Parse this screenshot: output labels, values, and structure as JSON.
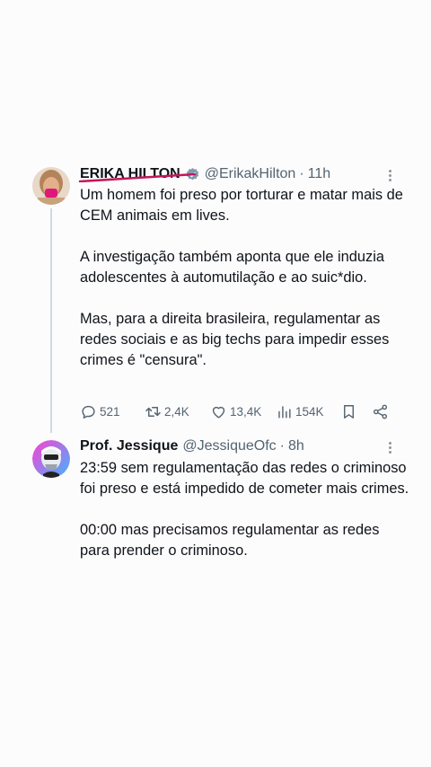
{
  "tweets": [
    {
      "name": "ERIKA HILTON",
      "handle": "@ErikakHilton",
      "dot": "·",
      "time": "11h",
      "paragraphs": [
        "Um homem foi preso por torturar e matar mais de CEM animais em lives.",
        "A investigação também aponta que ele induzia adolescentes à automutilação e ao suic*dio.",
        "Mas, para a direita brasileira, regulamentar as redes sociais e as big techs para impedir esses crimes é \"censura\"."
      ],
      "actions": {
        "replies": "521",
        "retweets": "2,4K",
        "likes": "13,4K",
        "views": "154K"
      },
      "verified": true
    },
    {
      "name": "Prof. Jessique",
      "handle": "@JessiqueOfc",
      "dot": "·",
      "time": "8h",
      "paragraphs": [
        "23:59 sem regulamentação das redes o criminoso foi preso e está impedido de cometer mais crimes.",
        "00:00 mas precisamos regulamentar as redes para prender o criminoso."
      ]
    }
  ],
  "colors": {
    "text": "#0f1419",
    "muted": "#536471",
    "verified": "#829aab",
    "annotation": "#c2185b"
  },
  "icons": [
    "reply-icon",
    "retweet-icon",
    "like-icon",
    "views-icon",
    "bookmark-icon",
    "share-icon",
    "more-icon",
    "verified-badge-icon"
  ]
}
